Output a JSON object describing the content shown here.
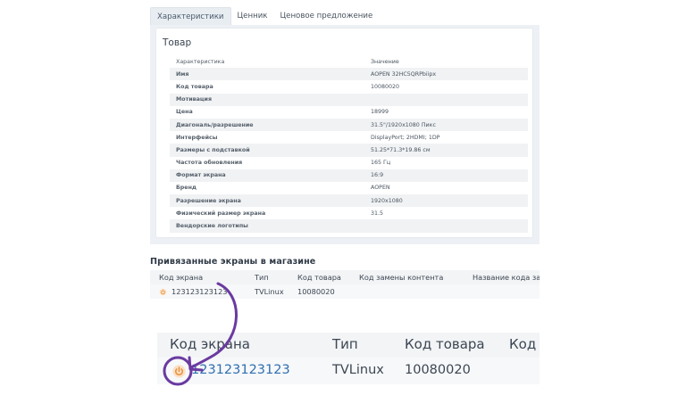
{
  "tabs": [
    {
      "label": "Характеристики",
      "active": true
    },
    {
      "label": "Ценник",
      "active": false
    },
    {
      "label": "Ценовое предложение",
      "active": false
    }
  ],
  "product": {
    "title": "Товар",
    "header": {
      "key": "Характеристика",
      "value": "Значение"
    },
    "rows": [
      {
        "key": "Имя",
        "value": "AOPEN 32HC5QRPbiipx"
      },
      {
        "key": "Код товара",
        "value": "10080020"
      },
      {
        "key": "Мотивация",
        "value": ""
      },
      {
        "key": "Цена",
        "value": "18999"
      },
      {
        "key": "Диагональ/разрешение",
        "value": "31.5\"/1920x1080 Пикс"
      },
      {
        "key": "Интерфейсы",
        "value": "DisplayPort; 2HDMI; 1DP"
      },
      {
        "key": "Размеры с подставкой",
        "value": "51.25*71.3*19.86 см"
      },
      {
        "key": "Частота обновления",
        "value": "165 Гц"
      },
      {
        "key": "Формат экрана",
        "value": "16:9"
      },
      {
        "key": "Бренд",
        "value": "AOPEN"
      },
      {
        "key": "Разрешение экрана",
        "value": "1920x1080"
      },
      {
        "key": "Физический размер экрана",
        "value": "31.5"
      },
      {
        "key": "Вендорские логотипы",
        "value": ""
      }
    ]
  },
  "screens": {
    "title": "Привязанные экраны в магазине",
    "columns": [
      "Код экрана",
      "Тип",
      "Код товара",
      "Код замены контента",
      "Название кода заме"
    ],
    "row": {
      "code": "123123123123",
      "type": "TVLinux",
      "product_code": "10080020"
    }
  },
  "zoom": {
    "columns": [
      "Код экрана",
      "Тип",
      "Код товара",
      "Код з"
    ],
    "row": {
      "code": "123123123123",
      "type": "TVLinux",
      "product_code": "10080020"
    }
  },
  "colors": {
    "power_icon": "#e8903a",
    "link": "#2f6fb0",
    "annotation": "#6a3aa0"
  }
}
